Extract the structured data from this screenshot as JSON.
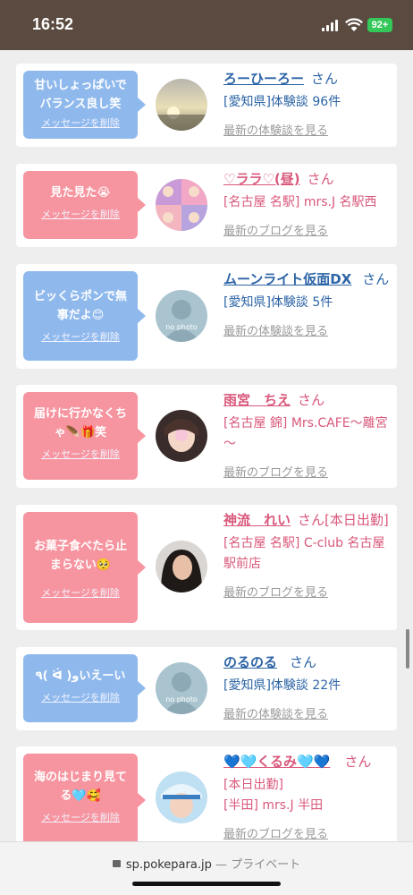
{
  "status": {
    "time": "16:52",
    "battery": "92+"
  },
  "colors": {
    "blue_bubble": "#8fb9ed",
    "pink_bubble": "#f6949f",
    "blue_text": "#2c64a6",
    "pink_text": "#d9587a"
  },
  "cards": [
    {
      "bubble_color": "blue",
      "message": "甘いしょっぱいでバランス良し笑",
      "delete_label": "メッセージを削除",
      "name": "ろーひーろー",
      "san": "さん",
      "sub": "[愛知県]体験談 96件",
      "latest": "最新の体験談を見る",
      "avatar": "sunset-photo"
    },
    {
      "bubble_color": "pink",
      "message": "見た見た😭",
      "delete_label": "メッセージを削除",
      "name": "♡ララ♡(昼)",
      "san": "さん",
      "sub": "[名古屋 名駅] mrs.J 名駅西",
      "latest": "最新のブログを見る",
      "avatar": "pink-hair-photo"
    },
    {
      "bubble_color": "blue",
      "message": "ビッくらポンで無事だよ😊",
      "delete_label": "メッセージを削除",
      "name": "ムーンライト仮面DX",
      "san": "さん",
      "sub": "[愛知県]体験談 5件",
      "latest": "最新の体験談を見る",
      "avatar": "no-photo",
      "avatar_label": "no photo"
    },
    {
      "bubble_color": "pink",
      "message": "届けに行かなくちゃ🪶🎁笑",
      "delete_label": "メッセージを削除",
      "name": "雨宮　ちえ",
      "san": "さん",
      "sub": "[名古屋 錦] Mrs.CAFE～離宮～",
      "latest": "最新のブログを見る",
      "avatar": "woman-photo"
    },
    {
      "bubble_color": "pink",
      "message": "お菓子食べたら止まらない🥺",
      "delete_label": "メッセージを削除",
      "name": "神流　れい",
      "san": "さん",
      "sub_note": "[本日出勤]",
      "sub": "[名古屋 名駅] C-club 名古屋駅前店",
      "latest": "最新のブログを見る",
      "avatar": "woman-photo-2"
    },
    {
      "bubble_color": "blue",
      "message": "٩( ᐛ )وいえーい",
      "delete_label": "メッセージを削除",
      "name": "のるのる",
      "san": "さん",
      "sub": "[愛知県]体験談 22件",
      "latest": "最新の体験談を見る",
      "avatar": "no-photo",
      "avatar_label": "no photo"
    },
    {
      "bubble_color": "pink",
      "message": "海のはじまり見てる🩵🥰",
      "delete_label": "メッセージを削除",
      "name": "💙🩵くるみ🩵💙",
      "san": "さん",
      "sub_note": "[本日出勤]",
      "sub": "[半田] mrs.J 半田",
      "latest": "最新のブログを見る",
      "avatar": "cap-photo"
    }
  ],
  "browser": {
    "url": "sp.pokepara.jp",
    "separator": "—",
    "mode": "プライベート"
  }
}
